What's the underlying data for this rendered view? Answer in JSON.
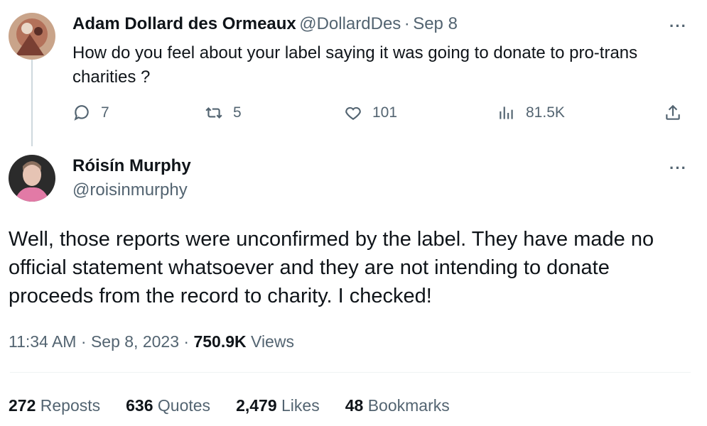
{
  "reply_to": {
    "author_name": "Adam Dollard des Ormeaux",
    "author_handle": "@DollardDes",
    "separator": "·",
    "date": "Sep 8",
    "text": "How do you feel about your label saying it was going to donate to pro-trans charities ?",
    "replies": "7",
    "reposts": "5",
    "likes": "101",
    "views": "81.5K",
    "more_label": "···"
  },
  "tweet": {
    "author_name": "Róisín Murphy",
    "author_handle": "@roisinmurphy",
    "more_label": "···",
    "text": "Well, those reports were unconfirmed by the label. They have made no official statement whatsoever and they are not intending to donate proceeds from the record to charity. I checked!",
    "time": "11:34 AM",
    "separator": "·",
    "date": "Sep 8, 2023",
    "views_count": "750.9K",
    "views_label": "Views",
    "stats": {
      "reposts_count": "272",
      "reposts_label": "Reposts",
      "quotes_count": "636",
      "quotes_label": "Quotes",
      "likes_count": "2,479",
      "likes_label": "Likes",
      "bookmarks_count": "48",
      "bookmarks_label": "Bookmarks"
    }
  },
  "colors": {
    "text": "#0f1419",
    "secondary": "#536471",
    "thread_line": "#cfd9de"
  },
  "icons": [
    "reply-icon",
    "repost-icon",
    "like-icon",
    "views-icon",
    "share-icon"
  ]
}
